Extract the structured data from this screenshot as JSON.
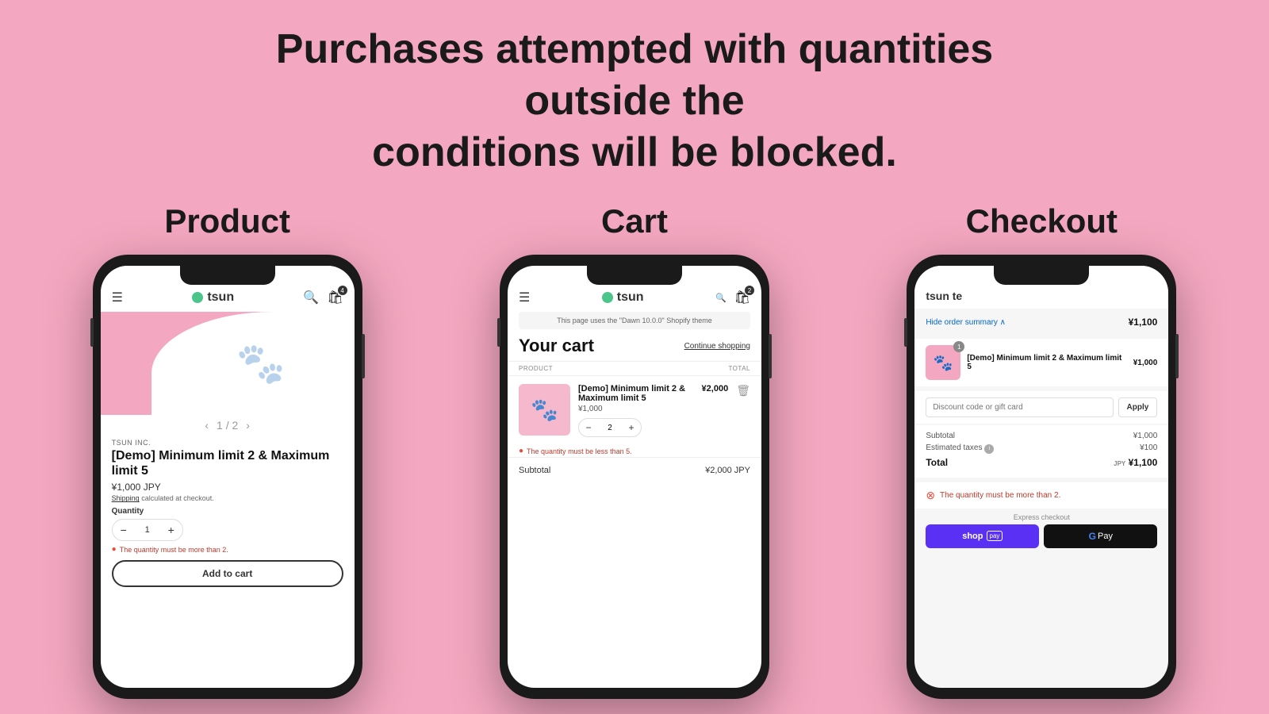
{
  "headline": {
    "line1": "Purchases attempted with quantities outside the",
    "line2": "conditions will be blocked."
  },
  "columns": {
    "product": {
      "title": "Product",
      "store": {
        "name": "tsun",
        "logo_color": "#4cc58a"
      },
      "vendor": "TSUN INC.",
      "product_name": "[Demo] Minimum limit 2 & Maximum limit 5",
      "price": "¥1,000 JPY",
      "shipping": "Shipping",
      "shipping_rest": "calculated at checkout.",
      "qty_label": "Quantity",
      "qty_value": "1",
      "error_msg": "The quantity must be more than 2.",
      "add_to_cart": "Add to cart",
      "img_nav": "1 / 2",
      "cart_count": "4"
    },
    "cart": {
      "title": "Cart",
      "store": {
        "name": "tsun"
      },
      "dawn_notice": "This page uses the \"Dawn 10.0.0\" Shopify theme",
      "cart_title": "Your cart",
      "continue_shopping": "Continue shopping",
      "col_product": "PRODUCT",
      "col_total": "TOTAL",
      "item_name": "[Demo] Minimum limit 2 & Maximum limit 5",
      "item_price": "¥1,000",
      "item_total": "¥2,000",
      "qty_value": "2",
      "cart_count": "2",
      "error_msg": "The quantity must be less than 5.",
      "subtotal_label": "Subtotal",
      "subtotal_value": "¥2,000 JPY"
    },
    "checkout": {
      "title": "Checkout",
      "store_name": "tsun te",
      "order_summary_link": "Hide order summary",
      "order_total": "¥1,100",
      "item_name": "[Demo] Minimum limit 2 & Maximum limit 5",
      "item_price": "¥1,000",
      "item_qty": "1",
      "discount_placeholder": "Discount code or gift card",
      "apply_label": "Apply",
      "subtotal_label": "Subtotal",
      "subtotal_value": "¥1,000",
      "taxes_label": "Estimated taxes",
      "taxes_info": "i",
      "taxes_value": "¥100",
      "total_label": "Total",
      "total_currency": "JPY",
      "total_value": "¥1,100",
      "error_msg": "The quantity must be more than 2.",
      "express_label": "Express checkout",
      "shop_pay_label": "shop",
      "shop_pay_sub": "pay",
      "gpay_label": "G Pay"
    }
  }
}
